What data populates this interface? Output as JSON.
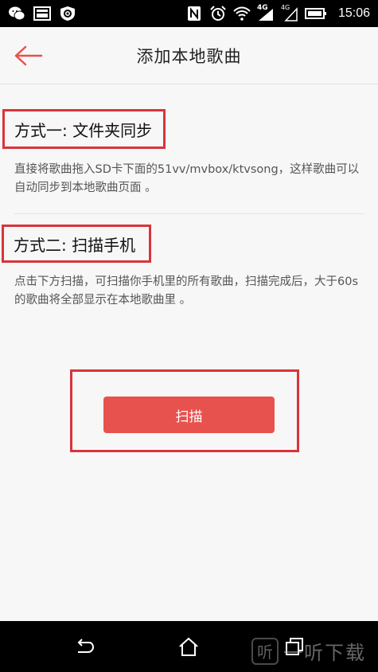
{
  "status_bar": {
    "left_icons": [
      "wechat-icon",
      "image-icon",
      "settings-shield-icon"
    ],
    "right_icons": [
      "nfc-icon",
      "alarm-icon",
      "wifi-icon",
      "4g-signal-icon",
      "4g-e-signal-icon",
      "battery-icon"
    ],
    "signal_label_1": "4G",
    "signal_label_2": "4G",
    "time": "15:06"
  },
  "app_bar": {
    "title": "添加本地歌曲",
    "back_icon": "arrow-left-icon"
  },
  "colors": {
    "accent": "#e8524e",
    "highlight_border": "#d9343a"
  },
  "content": {
    "method1": {
      "title": "方式一: 文件夹同步",
      "description": "直接将歌曲拖入SD卡下面的51vv/mvbox/ktvsong，这样歌曲可以自动同步到本地歌曲页面 。"
    },
    "method2": {
      "title": "方式二: 扫描手机",
      "description": "点击下方扫描，可扫描你手机里的所有歌曲，扫描完成后，大于60s的歌曲将全部显示在本地歌曲里 。"
    },
    "scan_button": "扫描"
  },
  "nav_bar": {
    "buttons": [
      "back-icon",
      "home-icon",
      "recent-apps-icon"
    ]
  },
  "watermark": {
    "badge": "听",
    "text": "一听下载"
  }
}
